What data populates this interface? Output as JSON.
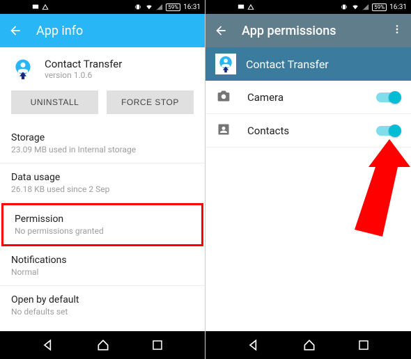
{
  "status": {
    "battery": "59%",
    "time": "16:31"
  },
  "left": {
    "header_title": "App info",
    "app_name": "Contact Transfer",
    "app_version": "version 1.0.6",
    "btn_uninstall": "UNINSTALL",
    "btn_force_stop": "FORCE STOP",
    "items": [
      {
        "title": "Storage",
        "sub": "23.09 MB used in Internal storage"
      },
      {
        "title": "Data usage",
        "sub": "26.18 KB used since 2 Sep"
      },
      {
        "title": "Permission",
        "sub": "No permissions granted"
      },
      {
        "title": "Notifications",
        "sub": "Normal"
      },
      {
        "title": "Open by default",
        "sub": "No defaults set"
      }
    ]
  },
  "right": {
    "header_title": "App permissions",
    "app_name": "Contact Transfer",
    "permissions": [
      {
        "label": "Camera"
      },
      {
        "label": "Contacts"
      }
    ]
  }
}
